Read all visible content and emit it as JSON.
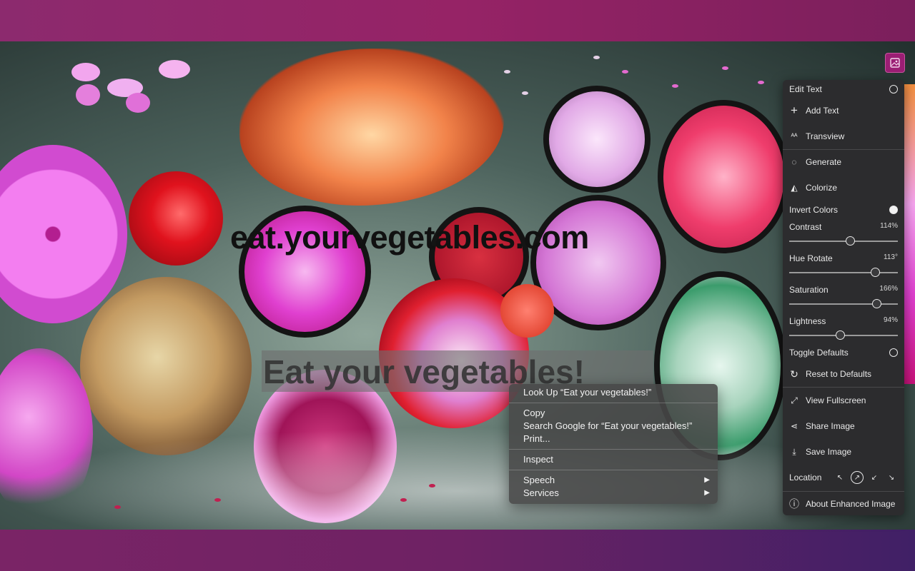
{
  "overlay": {
    "site_text": "eat.yourvegetables.com",
    "selected_text": "Eat your vegetables!"
  },
  "context_menu": {
    "look_up": "Look Up “Eat your vegetables!”",
    "copy": "Copy",
    "search_google": "Search Google for “Eat your vegetables!”",
    "print": "Print...",
    "inspect": "Inspect",
    "speech": "Speech",
    "services": "Services",
    "submenu_arrow": "▶"
  },
  "panel": {
    "edit_text": "Edit Text",
    "add_text": "Add Text",
    "transview": "Transview",
    "generate": "Generate",
    "colorize": "Colorize",
    "invert_colors": "Invert Colors",
    "contrast": {
      "label": "Contrast",
      "value_text": "114%",
      "position": 0.56
    },
    "hue_rotate": {
      "label": "Hue Rotate",
      "value_text": "113°",
      "position": 0.79
    },
    "saturation": {
      "label": "Saturation",
      "value_text": "166%",
      "position": 0.8
    },
    "lightness": {
      "label": "Lightness",
      "value_text": "94%",
      "position": 0.47
    },
    "toggle_defaults": "Toggle Defaults",
    "reset_defaults": "Reset to Defaults",
    "view_fullscreen": "View Fullscreen",
    "share_image": "Share Image",
    "save_image": "Save Image",
    "location": "Location",
    "about": "About Enhanced Image"
  },
  "icons": {
    "add": "+",
    "transview": "ᴬᴬ",
    "generate": "◌",
    "colorize": "◭",
    "reset": "↻",
    "fullscreen": "⤢",
    "share": "⋖",
    "save": "⤓",
    "about": "ⓘ",
    "loc_top_left": "↖",
    "loc_top_right": "↗",
    "loc_bottom_left": "↙",
    "loc_bottom_right": "↘"
  },
  "colors": {
    "panel_bg": "#2c2c2e",
    "context_menu_bg": "#484848",
    "extension_icon": "#9b1e74"
  }
}
